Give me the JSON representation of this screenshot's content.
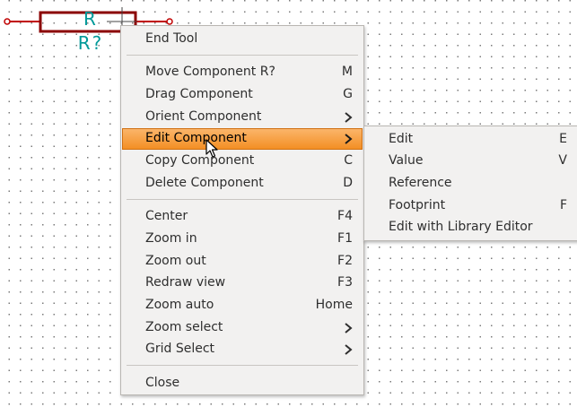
{
  "schematic": {
    "component_value": "R",
    "component_reference": "R?",
    "colors": {
      "body": "#8b0000",
      "text": "#009999",
      "wire": "#c00000"
    }
  },
  "context_menu": {
    "items": [
      {
        "label": "End Tool",
        "shortcut": ""
      },
      {
        "label": "Move Component R?",
        "shortcut": "M"
      },
      {
        "label": "Drag Component",
        "shortcut": "G"
      },
      {
        "label": "Orient Component",
        "shortcut": "",
        "submenu": true
      },
      {
        "label": "Edit Component",
        "shortcut": "",
        "submenu": true,
        "highlighted": true
      },
      {
        "label": "Copy Component",
        "shortcut": "C"
      },
      {
        "label": "Delete Component",
        "shortcut": "D"
      },
      {
        "label": "Center",
        "shortcut": "F4"
      },
      {
        "label": "Zoom in",
        "shortcut": "F1"
      },
      {
        "label": "Zoom out",
        "shortcut": "F2"
      },
      {
        "label": "Redraw view",
        "shortcut": "F3"
      },
      {
        "label": "Zoom auto",
        "shortcut": "Home"
      },
      {
        "label": "Zoom select",
        "shortcut": "",
        "submenu": true
      },
      {
        "label": "Grid Select",
        "shortcut": "",
        "submenu": true
      },
      {
        "label": "Close",
        "shortcut": ""
      }
    ]
  },
  "submenu": {
    "items": [
      {
        "label": "Edit",
        "shortcut": "E"
      },
      {
        "label": "Value",
        "shortcut": "V"
      },
      {
        "label": "Reference",
        "shortcut": ""
      },
      {
        "label": "Footprint",
        "shortcut": "F"
      },
      {
        "label": "Edit with Library Editor",
        "shortcut": ""
      }
    ]
  },
  "colors": {
    "highlight": "#f5a044",
    "menu_bg": "#f2f1f0"
  }
}
